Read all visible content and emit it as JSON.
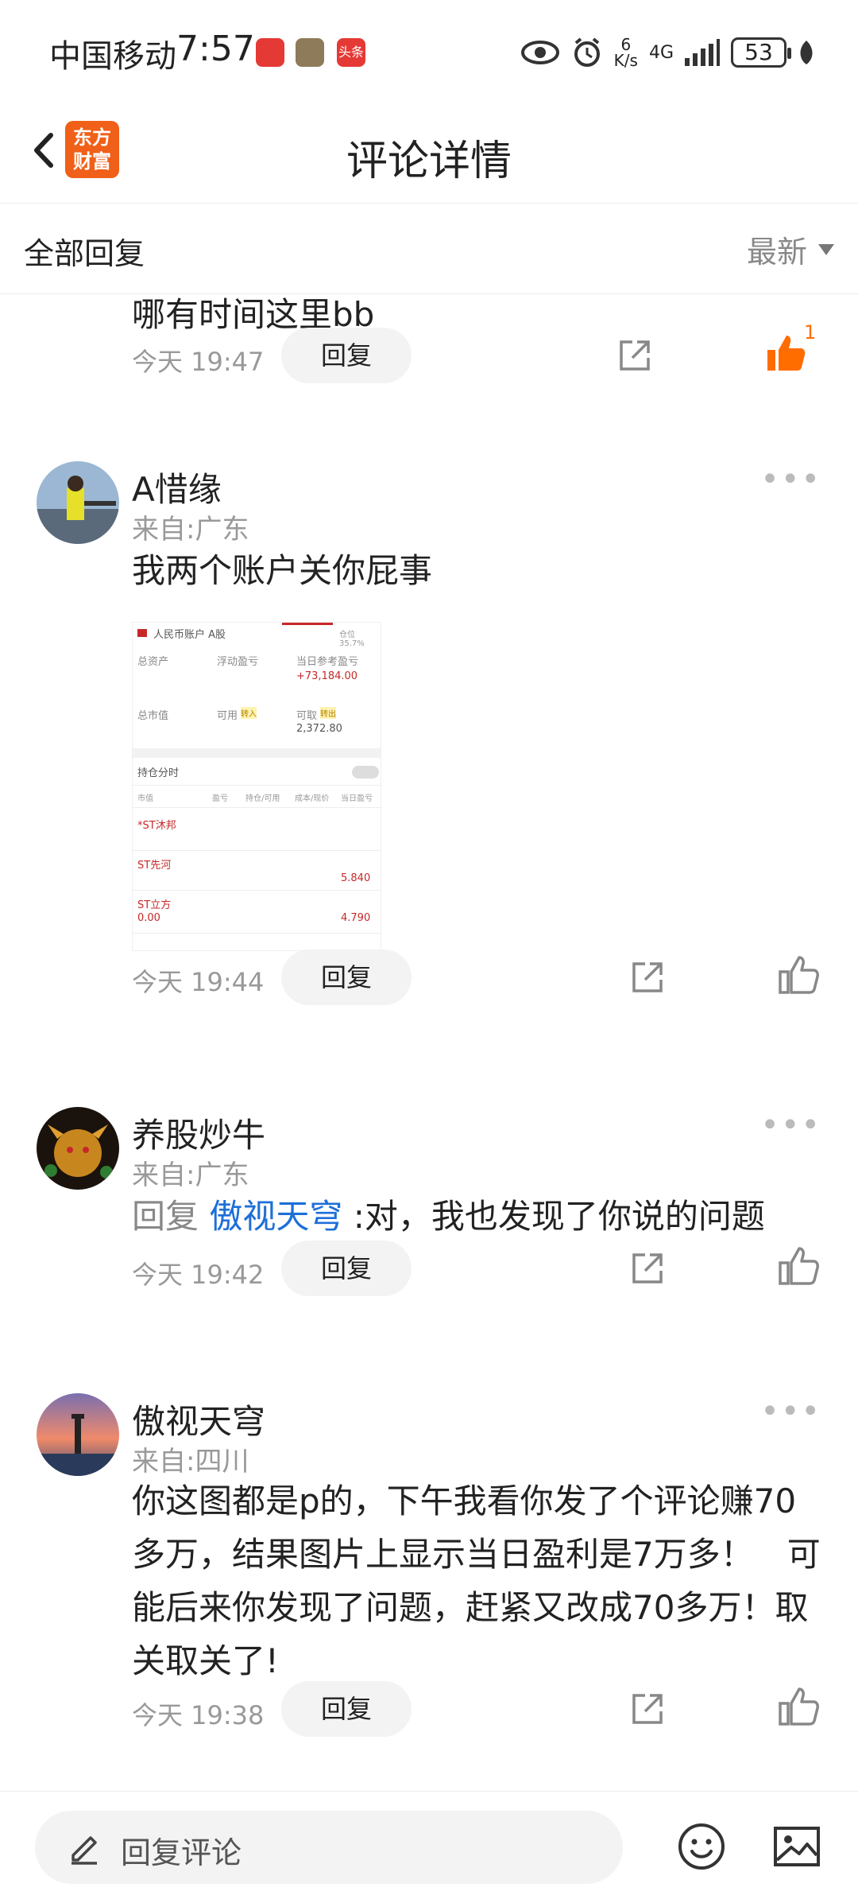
{
  "status_bar": {
    "carrier": "中国移动",
    "time": "7:57",
    "app_badge": "头条",
    "net_speed_value": "6",
    "net_speed_unit": "K/s",
    "network": "4G",
    "battery": "53"
  },
  "header": {
    "logo_line1": "东方",
    "logo_line2": "财富",
    "title": "评论详情"
  },
  "filter": {
    "label": "全部回复",
    "sort": "最新"
  },
  "comments": [
    {
      "text_partial": "哪有时间这里bb",
      "time": "今天 19:47",
      "reply_label": "回复",
      "like_count": "1"
    },
    {
      "username": "A惜缘",
      "location": "来自:广东",
      "text": "我两个账户关你屁事",
      "time": "今天 19:44",
      "reply_label": "回复",
      "screenshot": {
        "account": "人民币账户 A股",
        "position_ratio": "仓位 35.7%",
        "total_assets_label": "总资产",
        "float_pl_label": "浮动盈亏",
        "daily_pl_label": "当日参考盈亏",
        "daily_pl_value": "+73,184.00",
        "market_value_label": "总市值",
        "available_label": "可用",
        "transfer_in": "转入",
        "withdrawable_label": "可取",
        "transfer_out": "转出",
        "withdrawable_value": "2,372.80",
        "holding_label": "持仓分时",
        "col_market_value": "市值",
        "col_pl": "盈亏",
        "col_holding": "持仓/可用",
        "col_cost": "成本/现价",
        "col_daily": "当日盈亏",
        "stocks": [
          {
            "name": "*ST沐邦",
            "extra": "",
            "value": ""
          },
          {
            "name": "ST先河",
            "extra": "",
            "value": "5.840"
          },
          {
            "name": "ST立方",
            "extra": "0.00",
            "value": "4.790"
          }
        ]
      }
    },
    {
      "username": "养股炒牛",
      "location": "来自:广东",
      "reply_prefix": "回复",
      "reply_to": "傲视天穹",
      "text": ":对，我也发现了你说的问题",
      "time": "今天 19:42",
      "reply_label": "回复"
    },
    {
      "username": "傲视天穹",
      "location": "来自:四川",
      "text": "你这图都是p的，下午我看你发了个评论赚70多万，结果图片上显示当日盈利是7万多！　可能后来你发现了问题，赶紧又改成70多万！取关取关了!",
      "time": "今天 19:38",
      "reply_label": "回复"
    }
  ],
  "bottom_bar": {
    "placeholder": "回复评论"
  },
  "colors": {
    "brand_orange": "#f06018",
    "like_active": "#ff6d00",
    "link_blue": "#1e6fd8"
  }
}
